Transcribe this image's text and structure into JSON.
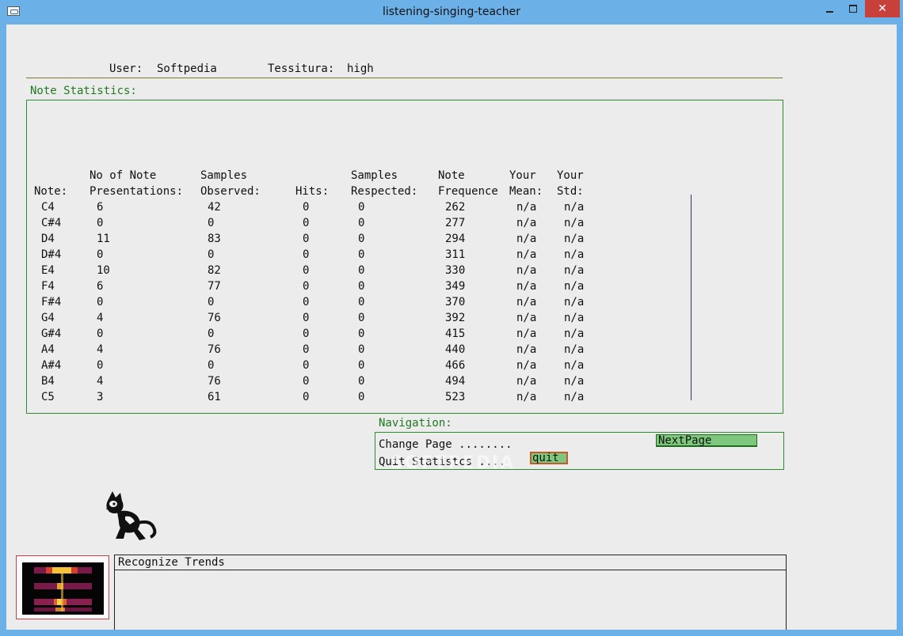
{
  "window": {
    "title": "listening-singing-teacher",
    "close_glyph": "✕"
  },
  "user_label": "User:",
  "user_value": "Softpedia",
  "tessitura_label": "Tessitura:",
  "tessitura_value": "high",
  "note_stats_title": "Note Statistics:",
  "headers_top": [
    "No of Note",
    "Samples",
    "Samples",
    "Note",
    "Your",
    "Your"
  ],
  "headers_bottom": [
    "Note:",
    "Presentations:",
    "Observed:",
    "Hits:",
    "Respected:",
    "Frequence",
    "Mean:",
    "Std:"
  ],
  "rows": [
    [
      "C4",
      "6",
      "42",
      "0",
      "0",
      "262",
      "n/a",
      "n/a"
    ],
    [
      "C#4",
      "0",
      "0",
      "0",
      "0",
      "277",
      "n/a",
      "n/a"
    ],
    [
      "D4",
      "11",
      "83",
      "0",
      "0",
      "294",
      "n/a",
      "n/a"
    ],
    [
      "D#4",
      "0",
      "0",
      "0",
      "0",
      "311",
      "n/a",
      "n/a"
    ],
    [
      "E4",
      "10",
      "82",
      "0",
      "0",
      "330",
      "n/a",
      "n/a"
    ],
    [
      "F4",
      "6",
      "77",
      "0",
      "0",
      "349",
      "n/a",
      "n/a"
    ],
    [
      "F#4",
      "0",
      "0",
      "0",
      "0",
      "370",
      "n/a",
      "n/a"
    ],
    [
      "G4",
      "4",
      "76",
      "0",
      "0",
      "392",
      "n/a",
      "n/a"
    ],
    [
      "G#4",
      "0",
      "0",
      "0",
      "0",
      "415",
      "n/a",
      "n/a"
    ],
    [
      "A4",
      "4",
      "76",
      "0",
      "0",
      "440",
      "n/a",
      "n/a"
    ],
    [
      "A#4",
      "0",
      "0",
      "0",
      "0",
      "466",
      "n/a",
      "n/a"
    ],
    [
      "B4",
      "4",
      "76",
      "0",
      "0",
      "494",
      "n/a",
      "n/a"
    ],
    [
      "C5",
      "3",
      "61",
      "0",
      "0",
      "523",
      "n/a",
      "n/a"
    ]
  ],
  "navigation": {
    "title": "Navigation:",
    "change_page_label": "Change Page ........",
    "next_button": "NextPage",
    "quit_label": "Quit Statistcs ....",
    "quit_button": "quit"
  },
  "watermark": "SOFTPEDIA",
  "trends": {
    "title": "Recognize Trends"
  },
  "colors": {
    "accent_green": "#1e7a1e",
    "button_fill": "#7ec87e",
    "titlebar": "#6cb0e8",
    "close_red": "#c7413a"
  }
}
